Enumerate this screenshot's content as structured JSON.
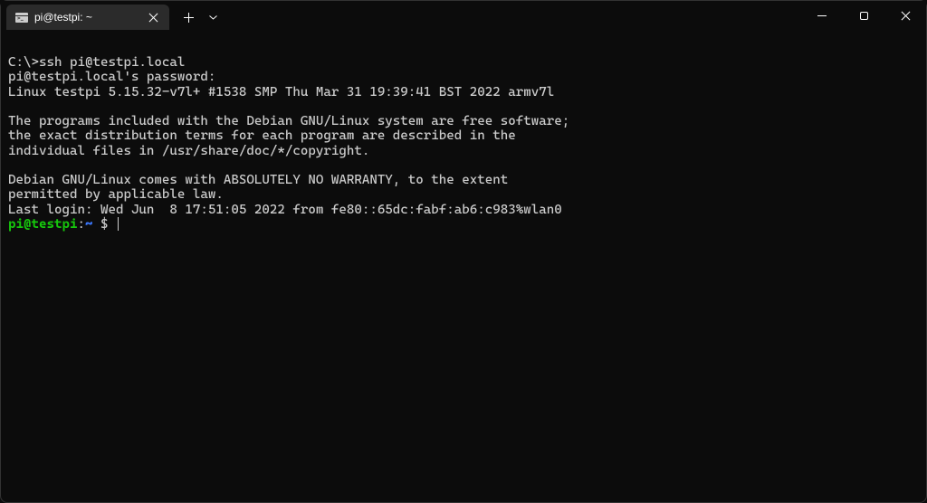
{
  "titlebar": {
    "tab": {
      "title": "pi@testpi: ~"
    }
  },
  "terminal": {
    "lines": [
      "",
      "C:\\>ssh pi@testpi.local",
      "pi@testpi.local's password:",
      "Linux testpi 5.15.32-v7l+ #1538 SMP Thu Mar 31 19:39:41 BST 2022 armv7l",
      "",
      "The programs included with the Debian GNU/Linux system are free software;",
      "the exact distribution terms for each program are described in the",
      "individual files in /usr/share/doc/*/copyright.",
      "",
      "Debian GNU/Linux comes with ABSOLUTELY NO WARRANTY, to the extent",
      "permitted by applicable law.",
      "Last login: Wed Jun  8 17:51:05 2022 from fe80::65dc:fabf:ab6:c983%wlan0"
    ],
    "prompt": {
      "user_host": "pi@testpi",
      "colon": ":",
      "path": "~",
      "dollar": " $ "
    }
  }
}
